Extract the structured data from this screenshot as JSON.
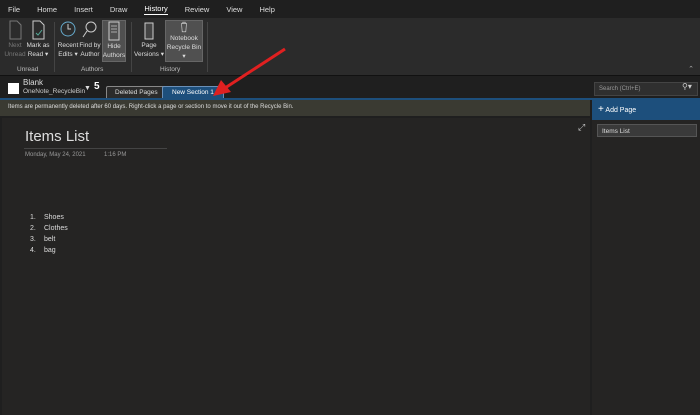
{
  "menu": [
    "File",
    "Home",
    "Insert",
    "Draw",
    "History",
    "Review",
    "View",
    "Help"
  ],
  "ribbon": {
    "next_unread": [
      "Next",
      "Unread"
    ],
    "mark_as_read": [
      "Mark as",
      "Read ▾"
    ],
    "recent_edits": [
      "Recent",
      "Edits ▾"
    ],
    "find_by_author": [
      "Find by",
      "Author"
    ],
    "hide_authors": [
      "Hide",
      "Authors"
    ],
    "page_versions": [
      "Page",
      "Versions ▾"
    ],
    "notebook_recycle_bin": [
      "Notebook",
      "Recycle Bin ▾"
    ],
    "groups": {
      "unread": "Unread",
      "authors": "Authors",
      "history": "History"
    }
  },
  "notebook": {
    "name": "Blank",
    "section_group": "OneNote_RecycleBin"
  },
  "tabs": [
    "Deleted Pages",
    "New Section 1"
  ],
  "search": {
    "placeholder": "Search (Ctrl+E)"
  },
  "info_bar": "Items are permanently deleted after 60 days. Right-click a page or section to move it out of the Recycle Bin.",
  "page": {
    "title": "Items List",
    "date": "Monday, May 24, 2021",
    "time": "1:16 PM",
    "list": [
      {
        "n": "1.",
        "t": "Shoes"
      },
      {
        "n": "2.",
        "t": "Clothes"
      },
      {
        "n": "3.",
        "t": "belt"
      },
      {
        "n": "4.",
        "t": "bag"
      }
    ]
  },
  "sidebar": {
    "add_page": "Add Page",
    "pages": [
      "Items List"
    ]
  },
  "colors": {
    "accent": "#1d4f7c",
    "arrow": "#e02020"
  }
}
